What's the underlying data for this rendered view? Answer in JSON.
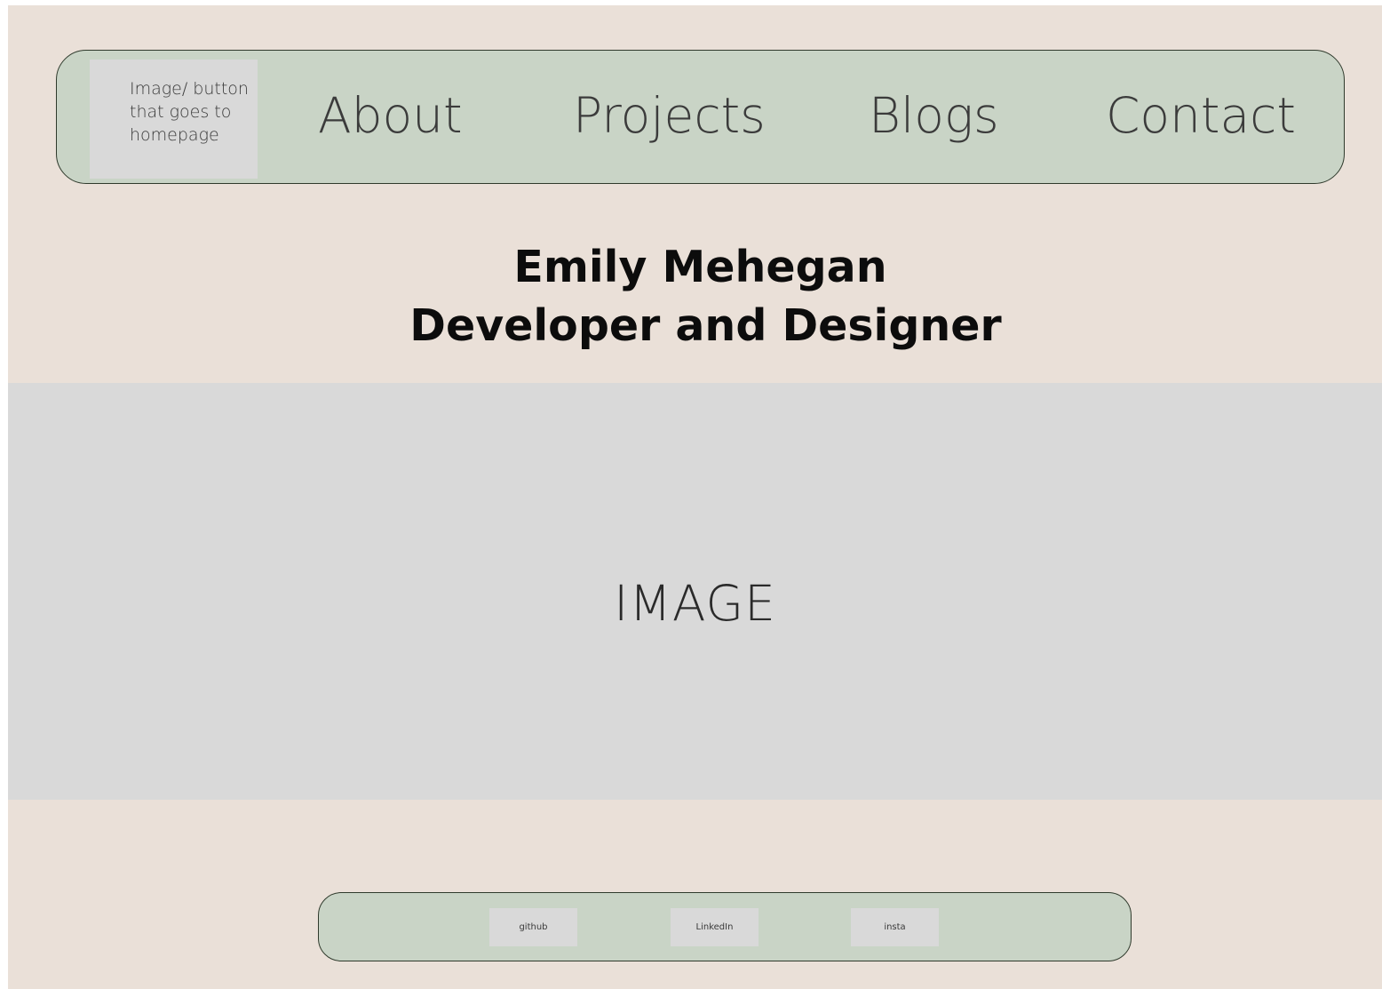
{
  "nav": {
    "home_button_label": "Image/ button that goes to homepage",
    "links": [
      {
        "label": "About"
      },
      {
        "label": "Projects"
      },
      {
        "label": "Blogs"
      },
      {
        "label": "Contact"
      }
    ]
  },
  "hero": {
    "name": "Emily Mehegan",
    "role": "Developer and Designer",
    "image_label": "IMAGE"
  },
  "footer": {
    "links": [
      {
        "label": "github"
      },
      {
        "label": "LinkedIn"
      },
      {
        "label": "insta"
      }
    ]
  },
  "colors": {
    "page_background": "#eae0d8",
    "nav_background": "#c9d4c6",
    "placeholder_gray": "#d9d9d9"
  }
}
